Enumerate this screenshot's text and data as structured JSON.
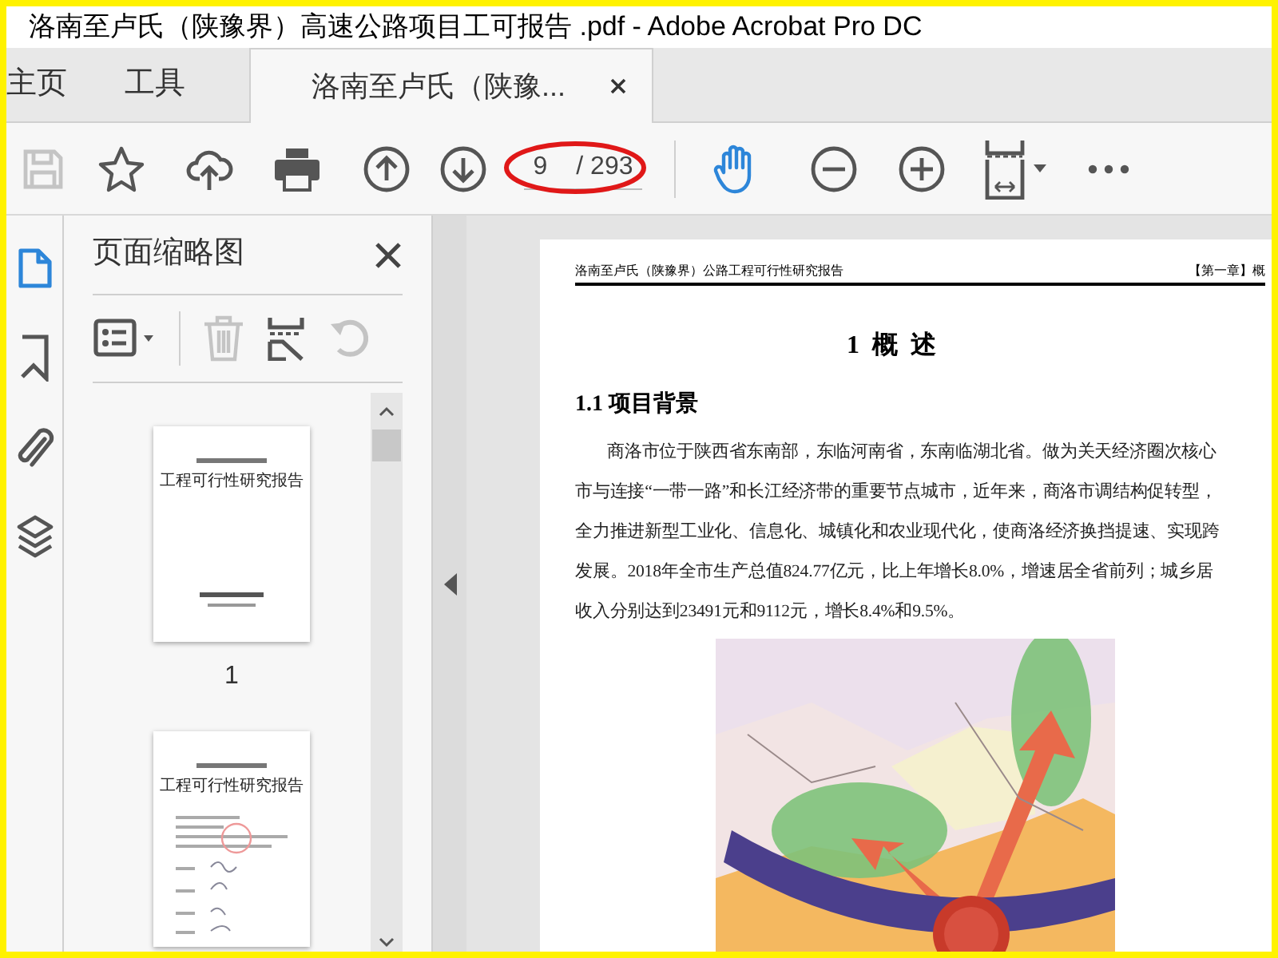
{
  "window": {
    "title": "洛南至卢氏（陕豫界）高速公路项目工可报告 .pdf - Adobe Acrobat Pro DC"
  },
  "tabs": [
    {
      "label": "主页",
      "selected": false
    },
    {
      "label": "工具",
      "selected": false
    },
    {
      "label": "洛南至卢氏（陕豫...",
      "selected": true
    }
  ],
  "toolbar": {
    "tools": [
      {
        "kind": "save",
        "disabled": true
      },
      {
        "kind": "star",
        "disabled": false
      },
      {
        "kind": "upload",
        "disabled": false
      },
      {
        "kind": "print",
        "disabled": false
      },
      {
        "kind": "prev",
        "disabled": false
      },
      {
        "kind": "next",
        "disabled": false
      },
      {
        "kind": "page"
      },
      {
        "kind": "hand",
        "selected": true
      },
      {
        "kind": "zoom_out",
        "disabled": false
      },
      {
        "kind": "zoom_in",
        "disabled": false
      },
      {
        "kind": "fit",
        "disabled": false
      },
      {
        "kind": "more",
        "disabled": false
      }
    ],
    "page_number": {
      "value": "9",
      "total": "/ 293"
    }
  },
  "sidebar": {
    "items": [
      {
        "kind": "pages",
        "selected": true
      },
      {
        "kind": "bookmarks",
        "selected": false
      },
      {
        "kind": "attachments",
        "selected": false
      },
      {
        "kind": "layers",
        "selected": false
      }
    ]
  },
  "panel": {
    "title": "页面缩略图",
    "tools": [
      {
        "kind": "options",
        "disabled": false
      },
      {
        "kind": "delete",
        "disabled": true
      },
      {
        "kind": "insert",
        "disabled": false
      },
      {
        "kind": "rotate",
        "disabled": true
      }
    ],
    "thumbnails": [
      {
        "title": "工程可行性研究报告",
        "label": "1"
      },
      {
        "title": "工程可行性研究报告"
      }
    ]
  },
  "document": {
    "header_left": "洛南至卢氏（陕豫界）公路工程可行性研究报告",
    "header_right": "【第一章】概",
    "heading": "1  概  述",
    "section": "1.1 项目背景",
    "paragraph_lines": [
      "商洛市位于陕西省东南部，东临河南省，东南临湖北省。做为关天经济圈次核心",
      "市与连接“一带一路”和长江经济带的重要节点城市，近年来，商洛市调结构促转型，",
      "全力推进新型工业化、信息化、城镇化和农业现代化，使商洛经济换挡提速、实现跨",
      "发展。2018年全市生产总值824.77亿元，比上年增长8.0%，增速居全省前列；城乡居",
      "收入分别达到23491元和9112元，增长8.4%和9.5%。"
    ]
  }
}
